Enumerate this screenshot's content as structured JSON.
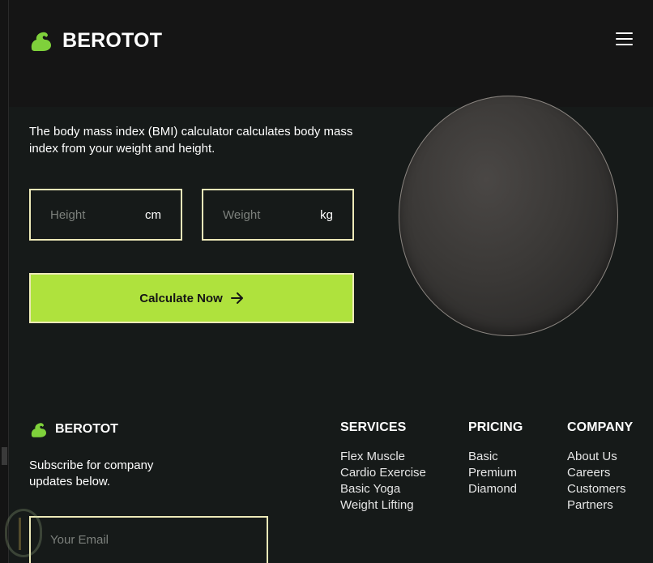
{
  "header": {
    "brand_name": "BEROTOT",
    "menu_icon": "hamburger-icon"
  },
  "bmi": {
    "description": "The body mass index (BMI) calculator calculates body mass index from your weight and height.",
    "height_placeholder": "Height",
    "height_unit": "cm",
    "weight_placeholder": "Weight",
    "weight_unit": "kg",
    "button_label": "Calculate Now"
  },
  "footer": {
    "brand_name": "BEROTOT",
    "subscribe_text": "Subscribe for company updates below.",
    "email_placeholder": "Your Email",
    "columns": [
      {
        "title": "SERVICES",
        "links": [
          "Flex Muscle",
          "Cardio Exercise",
          "Basic Yoga",
          "Weight Lifting"
        ]
      },
      {
        "title": "PRICING",
        "links": [
          "Basic",
          "Premium",
          "Diamond"
        ]
      },
      {
        "title": "COMPANY",
        "links": [
          "About Us",
          "Careers",
          "Customers",
          "Partners"
        ]
      }
    ]
  },
  "colors": {
    "accent": "#afe23d",
    "border": "#ede9b8",
    "background": "#161a19",
    "header_bg": "#151515"
  }
}
